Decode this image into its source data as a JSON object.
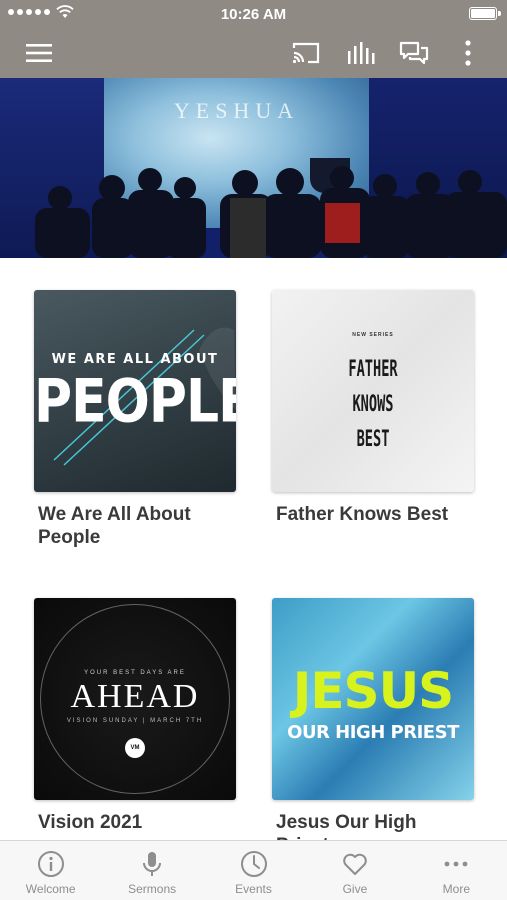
{
  "status_bar": {
    "time": "10:26 AM"
  },
  "nav": {
    "icons": [
      "menu-icon",
      "cast-icon",
      "equalizer-icon",
      "chat-icon",
      "more-vertical-icon"
    ]
  },
  "hero": {
    "screen_text": "YESHUA"
  },
  "sermons": [
    {
      "title": "We Are All About People",
      "art_small": "WE ARE ALL ABOUT",
      "art_big": "PEOPLE"
    },
    {
      "title": "Father Knows Best",
      "art_small": "NEW SERIES",
      "art_line1": "FATHER",
      "art_line2": "KNOWS",
      "art_line3": "BEST"
    },
    {
      "title": "Vision 2021",
      "art_small": "YOUR BEST DAYS ARE",
      "art_big": "AHEAD",
      "art_sub": "VISION SUNDAY | MARCH 7TH"
    },
    {
      "title": "Jesus Our High Priest",
      "art_big": "JESUS",
      "art_sub": "OUR HIGH PRIEST"
    }
  ],
  "tabs": [
    {
      "label": "Welcome",
      "icon": "info-icon"
    },
    {
      "label": "Sermons",
      "icon": "microphone-icon"
    },
    {
      "label": "Events",
      "icon": "clock-icon"
    },
    {
      "label": "Give",
      "icon": "heart-icon"
    },
    {
      "label": "More",
      "icon": "more-horizontal-icon"
    }
  ],
  "colors": {
    "header": "#8f8a84",
    "tab_inactive": "#8e8e8e",
    "title_text": "#3a3a3a"
  }
}
